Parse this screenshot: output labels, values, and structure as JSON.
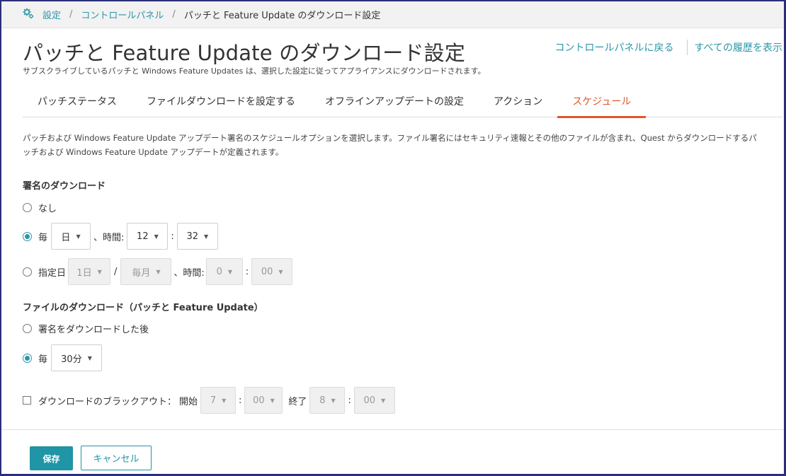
{
  "breadcrumb": {
    "settings": "設定",
    "control_panel": "コントロールパネル",
    "current": "パッチと Feature Update のダウンロード設定",
    "separator": "/"
  },
  "header": {
    "title": "パッチと Feature Update のダウンロード設定",
    "subtitle": "サブスクライブしているパッチと Windows Feature Updates は、選択した設定に従ってアプライアンスにダウンロードされます。",
    "link_back": "コントロールパネルに戻る",
    "link_history": "すべての履歴を表示"
  },
  "tabs": [
    {
      "label": "パッチステータス",
      "active": false
    },
    {
      "label": "ファイルダウンロードを設定する",
      "active": false
    },
    {
      "label": "オフラインアップデートの設定",
      "active": false
    },
    {
      "label": "アクション",
      "active": false
    },
    {
      "label": "スケジュール",
      "active": true
    }
  ],
  "description": {
    "line1": "パッチおよび Windows Feature Update アップデート署名のスケジュールオプションを選択します。ファイル署名にはセキュリティ速報とその他のファイルが含まれ、Quest からダウンロードするパ",
    "line2": "ッチおよび Windows Feature Update アップデートが定義されます。"
  },
  "signature_download": {
    "title": "署名のダウンロード",
    "option_none": "なし",
    "option_every": {
      "label": "毎",
      "interval": "日",
      "time_sep": "、時間:",
      "hour": "12",
      "colon": ":",
      "minute": "32"
    },
    "option_specified": {
      "label": "指定日",
      "day": "1日",
      "slash": "/",
      "month": "毎月",
      "time_sep": "、時間:",
      "hour": "0",
      "colon": ":",
      "minute": "00"
    },
    "selected": "every"
  },
  "file_download": {
    "title": "ファイルのダウンロード（パッチと Feature Update）",
    "option_after": "署名をダウンロードした後",
    "option_every": {
      "label": "毎",
      "interval": "30分"
    },
    "selected": "every"
  },
  "blackout": {
    "label": "ダウンロードのブラックアウト：",
    "start_label": "開始",
    "start_hour": "7",
    "start_minute": "00",
    "end_label": "終了",
    "end_hour": "8",
    "end_minute": "00",
    "colon": ":",
    "checked": false
  },
  "buttons": {
    "save": "保存",
    "cancel": "キャンセル"
  },
  "icons": {
    "caret": "▼",
    "settings": "gear-icon"
  },
  "colors": {
    "accent": "#2a96a8",
    "active_tab": "#e0562b",
    "save_bg": "#1f95a6"
  }
}
